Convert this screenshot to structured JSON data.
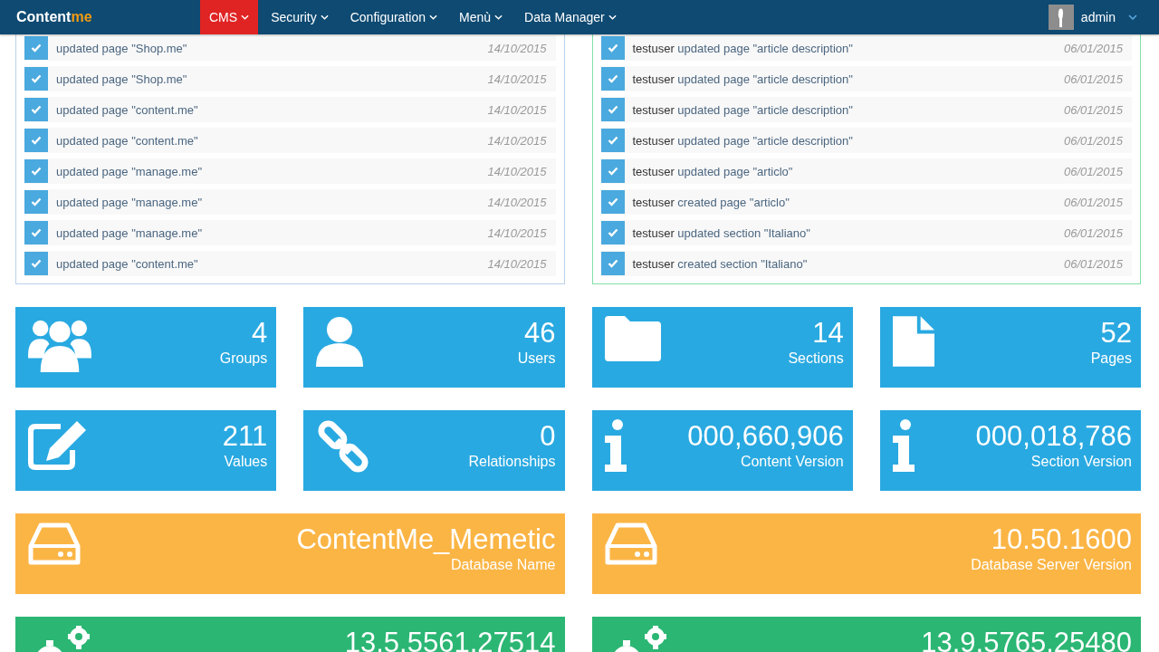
{
  "navbar": {
    "brand": {
      "text": "Content",
      "accent": "me"
    },
    "menu": [
      {
        "label": "CMS",
        "selected": true
      },
      {
        "label": "Security",
        "selected": false
      },
      {
        "label": "Configuration",
        "selected": false
      },
      {
        "label": "Menù",
        "selected": false
      },
      {
        "label": "Data Manager",
        "selected": false
      }
    ],
    "user": {
      "name": "admin"
    }
  },
  "left_activity": [
    {
      "text": "updated page \"Shop.me\"",
      "date": "14/10/2015",
      "checked": true
    },
    {
      "text": "updated page \"Shop.me\"",
      "date": "14/10/2015",
      "checked": true
    },
    {
      "text": "updated page \"content.me\"",
      "date": "14/10/2015",
      "checked": true
    },
    {
      "text": "updated page \"content.me\"",
      "date": "14/10/2015",
      "checked": true
    },
    {
      "text": "updated page \"manage.me\"",
      "date": "14/10/2015",
      "checked": true
    },
    {
      "text": "updated page \"manage.me\"",
      "date": "14/10/2015",
      "checked": true
    },
    {
      "text": "updated page \"manage.me\"",
      "date": "14/10/2015",
      "checked": true
    },
    {
      "text": "updated page \"content.me\"",
      "date": "14/10/2015",
      "checked": true
    }
  ],
  "right_activity": [
    {
      "user": "testuser",
      "text": "updated page \"article description\"",
      "date": "06/01/2015",
      "checked": true
    },
    {
      "user": "testuser",
      "text": "updated page \"article description\"",
      "date": "06/01/2015",
      "checked": true
    },
    {
      "user": "testuser",
      "text": "updated page \"article description\"",
      "date": "06/01/2015",
      "checked": true
    },
    {
      "user": "testuser",
      "text": "updated page \"article description\"",
      "date": "06/01/2015",
      "checked": true
    },
    {
      "user": "testuser",
      "text": "updated page \"articlo\"",
      "date": "06/01/2015",
      "checked": true
    },
    {
      "user": "testuser",
      "text": "created page \"articlo\"",
      "date": "06/01/2015",
      "checked": true
    },
    {
      "user": "testuser",
      "text": "updated section \"Italiano\"",
      "date": "06/01/2015",
      "checked": true
    },
    {
      "user": "testuser",
      "text": "created section \"Italiano\"",
      "date": "06/01/2015",
      "checked": true
    }
  ],
  "stat_rows": [
    [
      {
        "kind": "groups",
        "value": "4",
        "label": "Groups",
        "color": "#29a9e1"
      },
      {
        "kind": "users",
        "value": "46",
        "label": "Users",
        "color": "#29a9e1"
      },
      {
        "kind": "sections",
        "value": "14",
        "label": "Sections",
        "color": "#29a9e1"
      },
      {
        "kind": "pages",
        "value": "52",
        "label": "Pages",
        "color": "#29a9e1"
      }
    ],
    [
      {
        "kind": "values",
        "value": "211",
        "label": "Values",
        "color": "#29a9e1"
      },
      {
        "kind": "relationships",
        "value": "0",
        "label": "Relationships",
        "color": "#29a9e1"
      },
      {
        "kind": "info",
        "value": "000,660,906",
        "label": "Content Version",
        "color": "#29a9e1"
      },
      {
        "kind": "info",
        "value": "000,018,786",
        "label": "Section Version",
        "color": "#29a9e1"
      }
    ],
    [
      {
        "kind": "database",
        "value": "ContentMe_Memetic",
        "label": "Database Name",
        "color": "#fbb545"
      },
      {
        "kind": "database",
        "value": "10.50.1600",
        "label": "Database Server Version",
        "color": "#fbb545"
      }
    ],
    [
      {
        "kind": "gears",
        "value": "13.5.5561.27514",
        "color": "#2bb673"
      },
      {
        "kind": "gears",
        "value": "13.9.5765.25480",
        "color": "#2bb673"
      }
    ]
  ]
}
